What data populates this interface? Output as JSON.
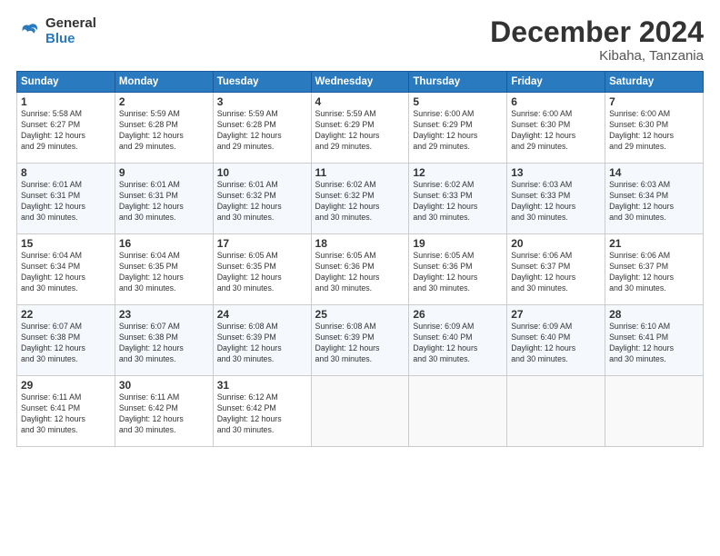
{
  "logo": {
    "general": "General",
    "blue": "Blue"
  },
  "title": {
    "month_year": "December 2024",
    "location": "Kibaha, Tanzania"
  },
  "days_of_week": [
    "Sunday",
    "Monday",
    "Tuesday",
    "Wednesday",
    "Thursday",
    "Friday",
    "Saturday"
  ],
  "weeks": [
    [
      {
        "day": "1",
        "info": "Sunrise: 5:58 AM\nSunset: 6:27 PM\nDaylight: 12 hours\nand 29 minutes."
      },
      {
        "day": "2",
        "info": "Sunrise: 5:59 AM\nSunset: 6:28 PM\nDaylight: 12 hours\nand 29 minutes."
      },
      {
        "day": "3",
        "info": "Sunrise: 5:59 AM\nSunset: 6:28 PM\nDaylight: 12 hours\nand 29 minutes."
      },
      {
        "day": "4",
        "info": "Sunrise: 5:59 AM\nSunset: 6:29 PM\nDaylight: 12 hours\nand 29 minutes."
      },
      {
        "day": "5",
        "info": "Sunrise: 6:00 AM\nSunset: 6:29 PM\nDaylight: 12 hours\nand 29 minutes."
      },
      {
        "day": "6",
        "info": "Sunrise: 6:00 AM\nSunset: 6:30 PM\nDaylight: 12 hours\nand 29 minutes."
      },
      {
        "day": "7",
        "info": "Sunrise: 6:00 AM\nSunset: 6:30 PM\nDaylight: 12 hours\nand 29 minutes."
      }
    ],
    [
      {
        "day": "8",
        "info": "Sunrise: 6:01 AM\nSunset: 6:31 PM\nDaylight: 12 hours\nand 30 minutes."
      },
      {
        "day": "9",
        "info": "Sunrise: 6:01 AM\nSunset: 6:31 PM\nDaylight: 12 hours\nand 30 minutes."
      },
      {
        "day": "10",
        "info": "Sunrise: 6:01 AM\nSunset: 6:32 PM\nDaylight: 12 hours\nand 30 minutes."
      },
      {
        "day": "11",
        "info": "Sunrise: 6:02 AM\nSunset: 6:32 PM\nDaylight: 12 hours\nand 30 minutes."
      },
      {
        "day": "12",
        "info": "Sunrise: 6:02 AM\nSunset: 6:33 PM\nDaylight: 12 hours\nand 30 minutes."
      },
      {
        "day": "13",
        "info": "Sunrise: 6:03 AM\nSunset: 6:33 PM\nDaylight: 12 hours\nand 30 minutes."
      },
      {
        "day": "14",
        "info": "Sunrise: 6:03 AM\nSunset: 6:34 PM\nDaylight: 12 hours\nand 30 minutes."
      }
    ],
    [
      {
        "day": "15",
        "info": "Sunrise: 6:04 AM\nSunset: 6:34 PM\nDaylight: 12 hours\nand 30 minutes."
      },
      {
        "day": "16",
        "info": "Sunrise: 6:04 AM\nSunset: 6:35 PM\nDaylight: 12 hours\nand 30 minutes."
      },
      {
        "day": "17",
        "info": "Sunrise: 6:05 AM\nSunset: 6:35 PM\nDaylight: 12 hours\nand 30 minutes."
      },
      {
        "day": "18",
        "info": "Sunrise: 6:05 AM\nSunset: 6:36 PM\nDaylight: 12 hours\nand 30 minutes."
      },
      {
        "day": "19",
        "info": "Sunrise: 6:05 AM\nSunset: 6:36 PM\nDaylight: 12 hours\nand 30 minutes."
      },
      {
        "day": "20",
        "info": "Sunrise: 6:06 AM\nSunset: 6:37 PM\nDaylight: 12 hours\nand 30 minutes."
      },
      {
        "day": "21",
        "info": "Sunrise: 6:06 AM\nSunset: 6:37 PM\nDaylight: 12 hours\nand 30 minutes."
      }
    ],
    [
      {
        "day": "22",
        "info": "Sunrise: 6:07 AM\nSunset: 6:38 PM\nDaylight: 12 hours\nand 30 minutes."
      },
      {
        "day": "23",
        "info": "Sunrise: 6:07 AM\nSunset: 6:38 PM\nDaylight: 12 hours\nand 30 minutes."
      },
      {
        "day": "24",
        "info": "Sunrise: 6:08 AM\nSunset: 6:39 PM\nDaylight: 12 hours\nand 30 minutes."
      },
      {
        "day": "25",
        "info": "Sunrise: 6:08 AM\nSunset: 6:39 PM\nDaylight: 12 hours\nand 30 minutes."
      },
      {
        "day": "26",
        "info": "Sunrise: 6:09 AM\nSunset: 6:40 PM\nDaylight: 12 hours\nand 30 minutes."
      },
      {
        "day": "27",
        "info": "Sunrise: 6:09 AM\nSunset: 6:40 PM\nDaylight: 12 hours\nand 30 minutes."
      },
      {
        "day": "28",
        "info": "Sunrise: 6:10 AM\nSunset: 6:41 PM\nDaylight: 12 hours\nand 30 minutes."
      }
    ],
    [
      {
        "day": "29",
        "info": "Sunrise: 6:11 AM\nSunset: 6:41 PM\nDaylight: 12 hours\nand 30 minutes."
      },
      {
        "day": "30",
        "info": "Sunrise: 6:11 AM\nSunset: 6:42 PM\nDaylight: 12 hours\nand 30 minutes."
      },
      {
        "day": "31",
        "info": "Sunrise: 6:12 AM\nSunset: 6:42 PM\nDaylight: 12 hours\nand 30 minutes."
      },
      {
        "day": "",
        "info": ""
      },
      {
        "day": "",
        "info": ""
      },
      {
        "day": "",
        "info": ""
      },
      {
        "day": "",
        "info": ""
      }
    ]
  ]
}
